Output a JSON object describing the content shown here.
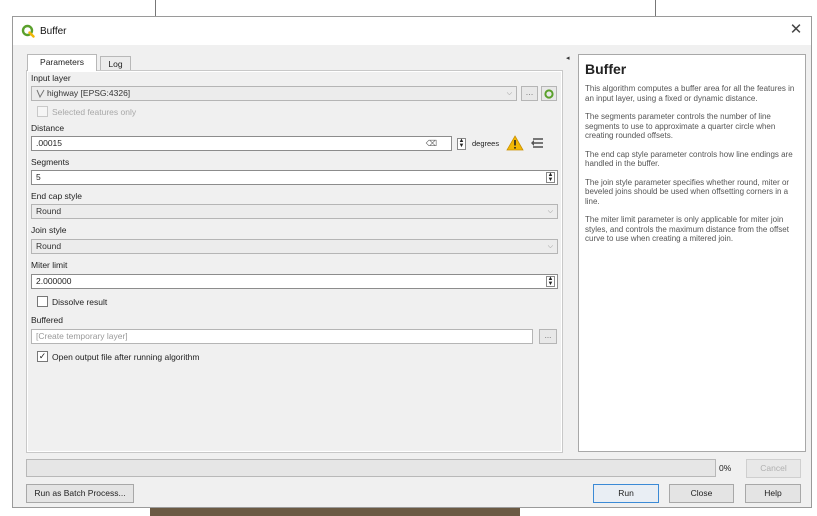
{
  "dialog": {
    "title": "Buffer"
  },
  "tabs": [
    {
      "label": "Parameters"
    },
    {
      "label": "Log"
    }
  ],
  "form": {
    "input_layer": {
      "label": "Input layer",
      "value": "highway [EPSG:4326]"
    },
    "selected_only": {
      "label": "Selected features only",
      "checked": false
    },
    "distance": {
      "label": "Distance",
      "value": ".00015",
      "unit": "degrees"
    },
    "segments": {
      "label": "Segments",
      "value": "5"
    },
    "end_cap": {
      "label": "End cap style",
      "value": "Round"
    },
    "join_style": {
      "label": "Join style",
      "value": "Round"
    },
    "miter_limit": {
      "label": "Miter limit",
      "value": "2.000000"
    },
    "dissolve": {
      "label": "Dissolve result",
      "checked": false
    },
    "buffered": {
      "label": "Buffered",
      "placeholder": "[Create temporary layer]",
      "browse": "..."
    },
    "open_output": {
      "label": "Open output file after running algorithm",
      "checked": true
    }
  },
  "help": {
    "title": "Buffer",
    "paragraphs": [
      "This algorithm computes a buffer area for all the features in an input layer, using a fixed or dynamic distance.",
      "The segments parameter controls the number of line segments to use to approximate a quarter circle when creating rounded offsets.",
      "The end cap style parameter controls how line endings are handled in the buffer.",
      "The join style parameter specifies whether round, miter or beveled joins should be used when offsetting corners in a line.",
      "The miter limit parameter is only applicable for miter join styles, and controls the maximum distance from the offset curve to use when creating a mitered join."
    ]
  },
  "footer": {
    "progress": 0,
    "progress_label": "0%",
    "cancel": "Cancel",
    "batch": "Run as Batch Process...",
    "run": "Run",
    "close": "Close",
    "help": "Help"
  },
  "colors": {
    "warning": "#f2b705",
    "qgis_green": "#5aa02c",
    "default_button_border": "#3b8ad6"
  }
}
